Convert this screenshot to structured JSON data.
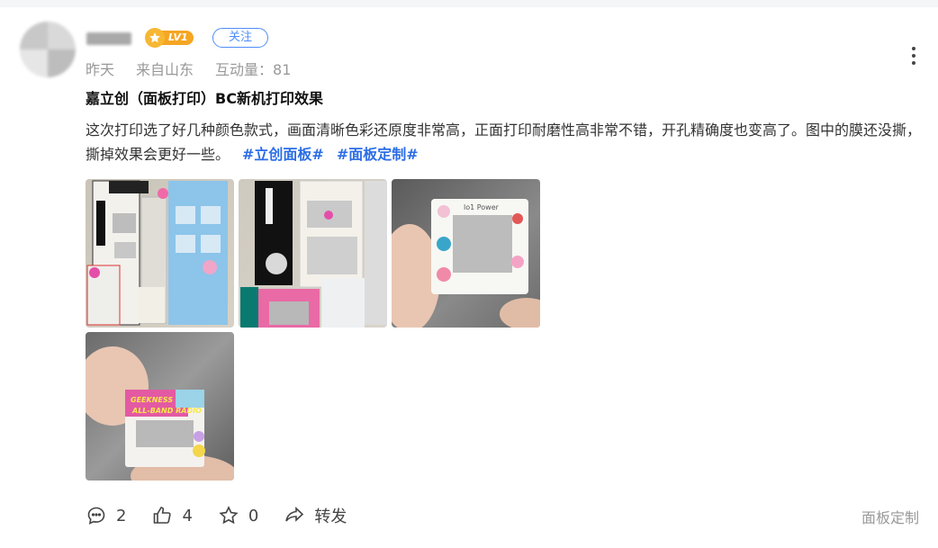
{
  "user": {
    "level": "LV1",
    "follow_label": "关注"
  },
  "meta": {
    "time": "昨天",
    "location": "来自山东",
    "interactions": "互动量：81"
  },
  "post": {
    "title": "嘉立创（面板打印）BC新机打印效果",
    "body": "这次打印选了好几种颜色款式，画面清晰色彩还原度非常高，正面打印耐磨性高非常不错，开孔精确度也变高了。图中的膜还没撕，撕掉效果会更好一些。",
    "hashtags": [
      "#立创面板#",
      "#面板定制#"
    ]
  },
  "images": {
    "img3_label": "lo1 Power",
    "img4_line1": "GEEKNESS",
    "img4_line2": "ALL-BAND RADIO"
  },
  "actions": {
    "comments": "2",
    "likes": "4",
    "favorites": "0",
    "share_label": "转发"
  },
  "footer_tag": "面板定制",
  "colors": {
    "accent": "#2b6de6",
    "badge": "#f5a623",
    "follow": "#4e8ef7"
  }
}
